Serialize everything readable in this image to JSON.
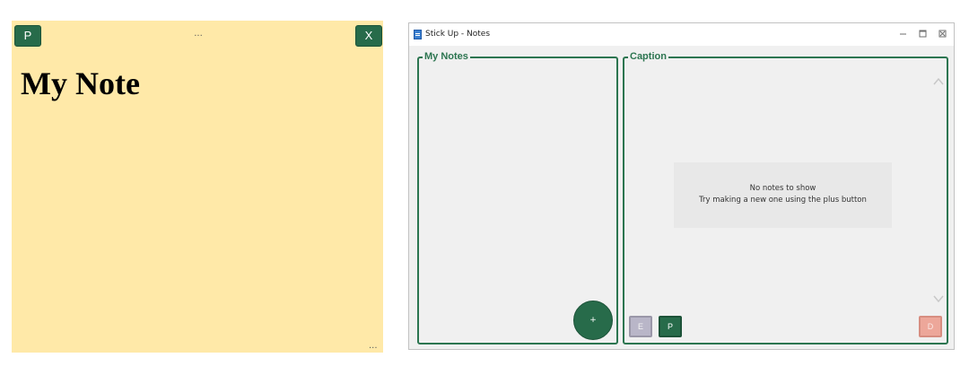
{
  "sticky_note": {
    "pin_label": "P",
    "close_label": "X",
    "drag_handle": "...",
    "title": "My Note",
    "resize_grip": "...",
    "background_color": "#ffe9a8",
    "button_color": "#276b4a"
  },
  "window": {
    "title": "Stick Up - Notes",
    "controls": {
      "minimize": "–",
      "maximize": "□",
      "close": "✕"
    }
  },
  "notes_panel": {
    "legend": "My Notes",
    "add_button_label": "+"
  },
  "caption_panel": {
    "legend": "Caption",
    "empty_message_line1": "No notes to show",
    "empty_message_line2": "Try making a new one using the plus button",
    "edit_button_label": "E",
    "pin_button_label": "P",
    "delete_button_label": "D"
  },
  "colors": {
    "accent": "#276b4a",
    "group_border": "#2c7550",
    "disabled_edit": "#b9b6c8",
    "delete": "#eda79a"
  }
}
